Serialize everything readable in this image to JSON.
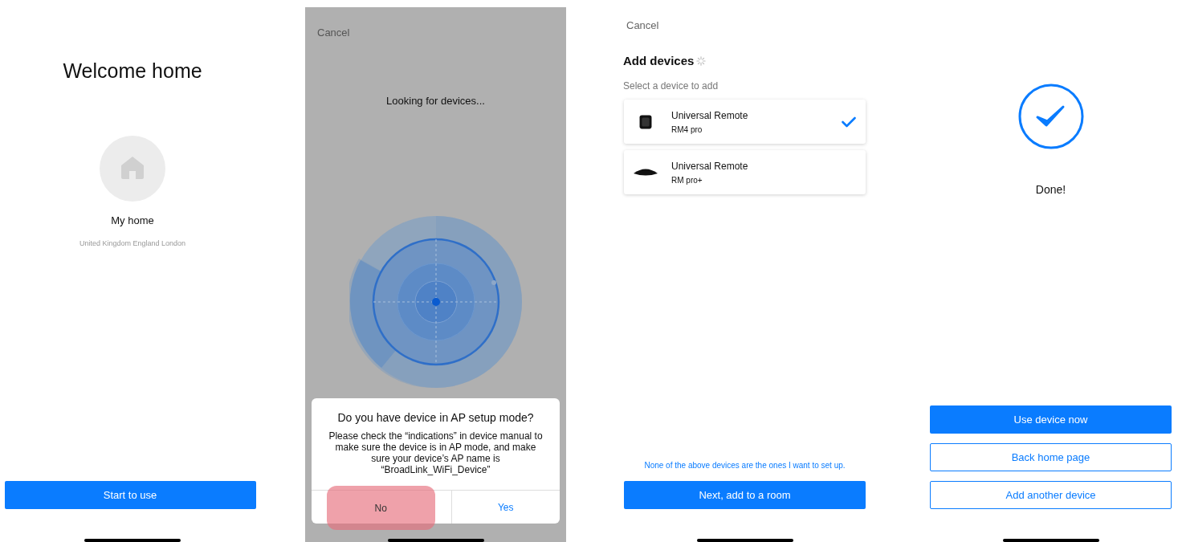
{
  "welcome_screen": {
    "title": "Welcome home",
    "home_name": "My home",
    "location": "United Kingdom England London",
    "start_button": "Start to use"
  },
  "search_screen": {
    "cancel": "Cancel",
    "status": "Looking for devices...",
    "dialog": {
      "title": "Do you have device in AP setup mode?",
      "message": "Please check the “indications” in device manual to make sure the device is in AP mode, and make sure your device’s AP name is “BroadLink_WiFi_Device”",
      "buttons": [
        {
          "label": "No",
          "highlighted": true
        },
        {
          "label": "Yes",
          "highlighted": false
        }
      ]
    }
  },
  "add_screen": {
    "cancel": "Cancel",
    "title": "Add devices",
    "subtitle": "Select a device to add",
    "devices": [
      {
        "name": "Universal Remote",
        "model": "RM4 pro",
        "kind": "cube",
        "selected": true
      },
      {
        "name": "Universal Remote",
        "model": "RM pro+",
        "kind": "puck",
        "selected": false
      }
    ],
    "none_link": "None of the above devices are the ones I want to set up.",
    "next_button": "Next, add to a room"
  },
  "done_screen": {
    "message": "Done!",
    "buttons": [
      {
        "label": "Use device now",
        "kind": "primary"
      },
      {
        "label": "Back home page",
        "kind": "outline"
      },
      {
        "label": "Add another device",
        "kind": "outline"
      }
    ]
  }
}
